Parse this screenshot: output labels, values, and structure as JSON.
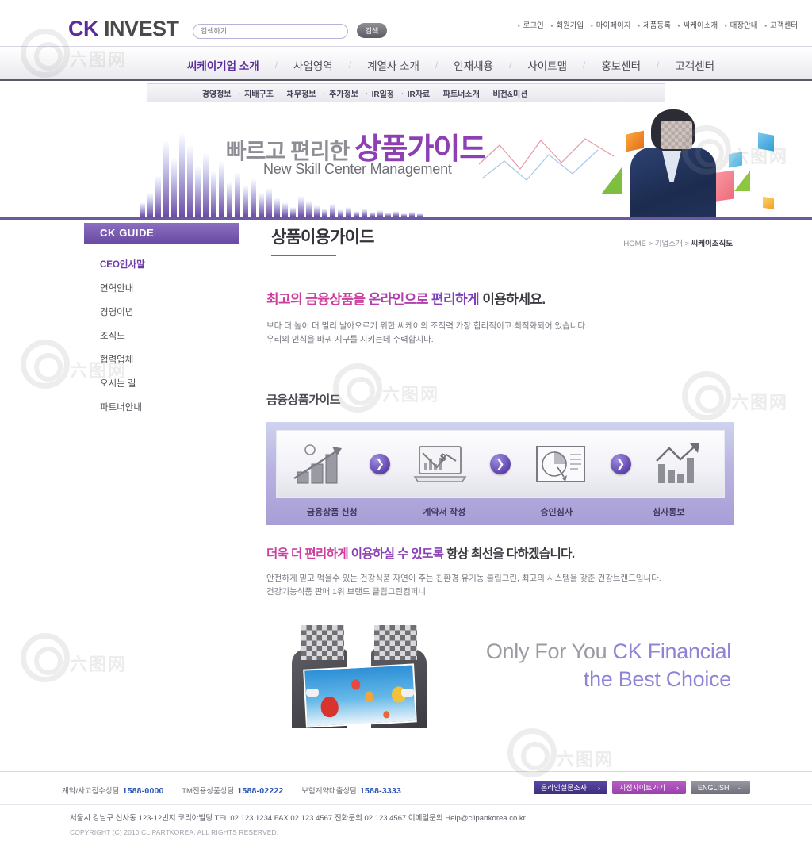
{
  "header": {
    "logo_ck": "CK",
    "logo_rest": " INVEST",
    "search": {
      "value": "",
      "placeholder": "검색하기",
      "button": "검색"
    },
    "util_links": [
      "로그인",
      "회원가입",
      "마이페이지",
      "제품등록",
      "씨케이소개",
      "매장안내",
      "고객센터"
    ]
  },
  "mainnav": {
    "items": [
      {
        "label": "씨케이기업 소개",
        "active": true
      },
      {
        "label": "사업영역",
        "active": false
      },
      {
        "label": "계열사 소개",
        "active": false
      },
      {
        "label": "인재채용",
        "active": false
      },
      {
        "label": "사이트맵",
        "active": false
      },
      {
        "label": "홍보센터",
        "active": false
      },
      {
        "label": "고객센터",
        "active": false
      }
    ],
    "separator": "/"
  },
  "subnav": {
    "items": [
      "경영정보",
      "지배구조",
      "채무정보",
      "추가정보",
      "IR일정",
      "IR자료",
      "파트너소개",
      "비전&미션"
    ]
  },
  "banner": {
    "title_gray": "빠르고 편리한",
    "title_highlight": "상품가이드",
    "subtitle": "New Skill Center Management"
  },
  "sidebar": {
    "heading": "CK GUIDE",
    "items": [
      {
        "label": "CEO인사말",
        "active": true
      },
      {
        "label": "연혁안내",
        "active": false
      },
      {
        "label": "경영이념",
        "active": false
      },
      {
        "label": "조직도",
        "active": false
      },
      {
        "label": "협력업체",
        "active": false
      },
      {
        "label": "오시는 길",
        "active": false
      },
      {
        "label": "파트너안내",
        "active": false
      }
    ]
  },
  "main": {
    "page_title": "상품이용가이드",
    "breadcrumb": {
      "home": "HOME",
      "sep1": " > ",
      "mid": "기업소개",
      "sep2": " > ",
      "current": "씨케이조직도"
    },
    "lead": {
      "h_part1": "최고의 금융상품을",
      "h_part2": " 온라인으로",
      "h_part3": " 편리하게",
      "h_part4": " 이용하세요.",
      "body_line1": "보다 더 높이 더 멀리 날아오르기 위한 씨케이의 조직력 가장 합리적이고 최적화되어 있습니다.",
      "body_line2": "우리의 인식을 바꿔 지구를 지키는데 주력합시다."
    },
    "section_title": "금융상품가이드",
    "process": {
      "steps": [
        {
          "label": "금융상품 신청",
          "icon": "bar-chart-growth-icon"
        },
        {
          "label": "계약서 작성",
          "icon": "laptop-dollar-icon"
        },
        {
          "label": "승인심사",
          "icon": "pie-chart-report-icon"
        },
        {
          "label": "심사통보",
          "icon": "bar-chart-arrow-icon"
        }
      ],
      "arrow_glyph": "❯"
    },
    "lead2": {
      "h_part1": "더욱 더 편리하게",
      "h_part2": " 이용하실 수 있도록",
      "h_part3": " 항상 최선을 다하겠습니다.",
      "body_line1": "안전하게 믿고 먹을수 있는 건강식품 자연이 주는 친환경 유기농 클립그린, 최고의 시스템을 갖춘 건강브랜드입니다.",
      "body_line2": "건강기능식품 판매 1위 브랜드 클립그린컴퍼니"
    },
    "promo": {
      "line1_gray": "Only For You ",
      "line1_purple": "CK Financial",
      "line2": "the Best Choice"
    }
  },
  "footer": {
    "tels": [
      {
        "label": "계약/사고접수상담",
        "number": "1588-0000"
      },
      {
        "label": "TM전용상품상담",
        "number": "1588-02222"
      },
      {
        "label": "보험계약대출상담",
        "number": "1588-3333"
      }
    ],
    "buttons": [
      {
        "label": "온라인설문조사",
        "arrow": "›"
      },
      {
        "label": "지점사이트가기",
        "arrow": "›"
      },
      {
        "label": "ENGLISH",
        "arrow": "⌄"
      }
    ],
    "address": "서울시 강남구 신사동 123-12번지 코리아빌딩  TEL 02.123.1234  FAX 02.123.4567  전화문의 02.123.4567  이메일문의  Help@clipartkorea.co.kr",
    "copyright": "COPYRIGHT (C) 2010 CLIPARTKOREA. ALL RIGHTS RESERVED."
  },
  "watermark": {
    "text": "六图网"
  },
  "colors": {
    "brand_purple": "#5b2d9b",
    "accent_magenta": "#cc3f9e",
    "link_blue": "#2a55b5",
    "nav_dark": "#585866"
  }
}
